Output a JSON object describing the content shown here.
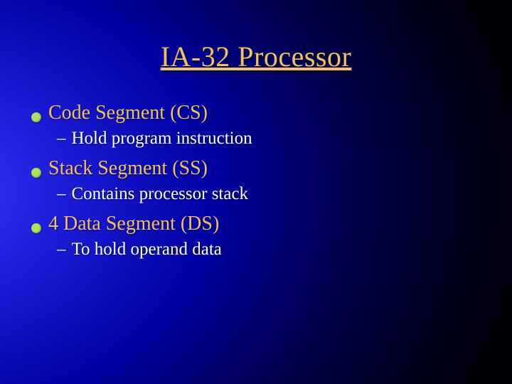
{
  "title": "IA-32 Processor",
  "bullets": [
    {
      "label": "Code Segment (CS)",
      "sub": "Hold program instruction"
    },
    {
      "label": "Stack Segment (SS)",
      "sub": "Contains processor stack"
    },
    {
      "label": "4 Data Segment (DS)",
      "sub": "To hold operand data"
    }
  ]
}
